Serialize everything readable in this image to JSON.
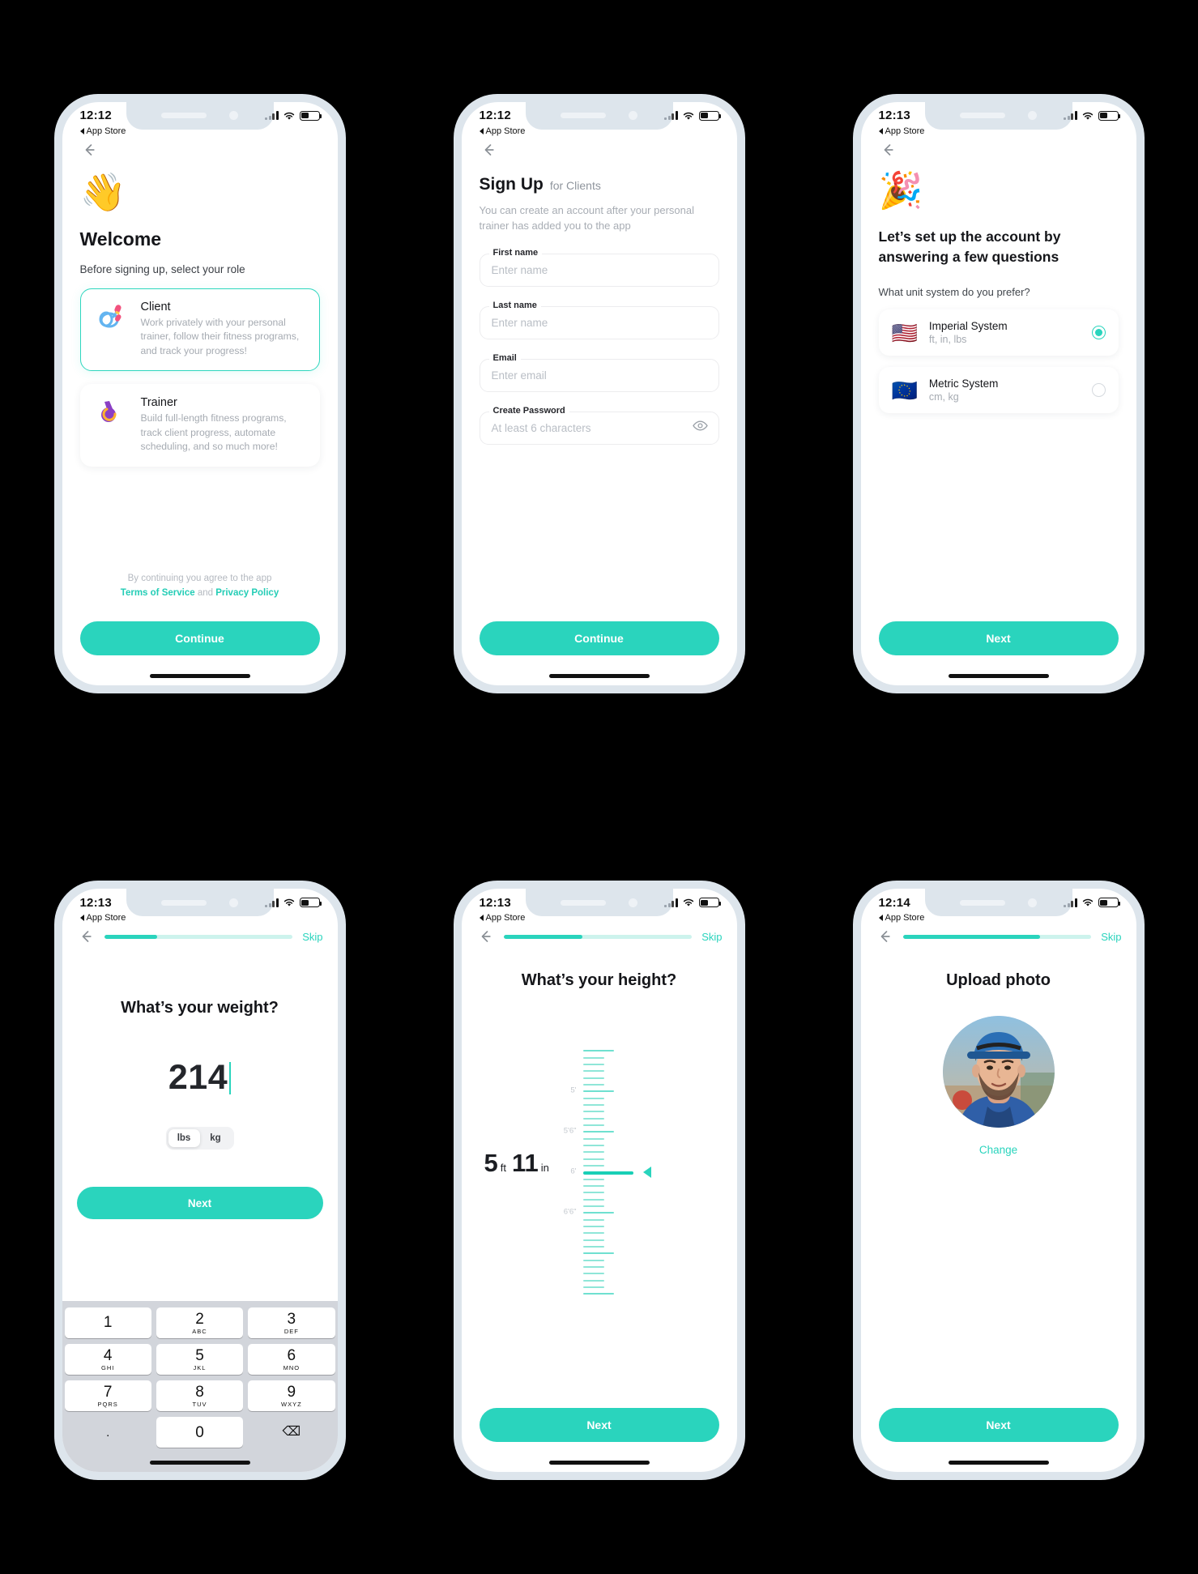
{
  "statusbar": {
    "back_label": "App Store"
  },
  "screens": [
    {
      "id": "welcome",
      "time": "12:12",
      "emoji": "👋",
      "title": "Welcome",
      "subtitle": "Before signing up, select your role",
      "roles": [
        {
          "title": "Client",
          "desc": "Work privately with your personal trainer, follow their fitness programs, and track your progress!",
          "selected": true
        },
        {
          "title": "Trainer",
          "desc": "Build full-length fitness programs, track client progress, automate scheduling, and so much more!",
          "selected": false
        }
      ],
      "terms_prefix": "By continuing you agree to the app",
      "terms_link1": "Terms of Service",
      "terms_and": "and",
      "terms_link2": "Privacy Policy",
      "cta": "Continue"
    },
    {
      "id": "signup",
      "time": "12:12",
      "title_bold": "Sign Up",
      "title_light": "for Clients",
      "desc": "You can create an account after your personal trainer has added you to the app",
      "fields": [
        {
          "label": "First name",
          "placeholder": "Enter name",
          "value": ""
        },
        {
          "label": "Last name",
          "placeholder": "Enter name",
          "value": ""
        },
        {
          "label": "Email",
          "placeholder": "Enter email",
          "value": ""
        },
        {
          "label": "Create Password",
          "placeholder": "At least 6 characters",
          "value": ""
        }
      ],
      "cta": "Continue"
    },
    {
      "id": "setup",
      "time": "12:13",
      "emoji": "🎉",
      "title": "Let’s set up the account by answering a few questions",
      "question": "What unit system do you prefer?",
      "options": [
        {
          "flag": "🇺🇸",
          "name": "Imperial System",
          "sub": "ft, in, lbs",
          "selected": true
        },
        {
          "flag": "🇪🇺",
          "name": "Metric System",
          "sub": "cm, kg",
          "selected": false
        }
      ],
      "cta": "Next"
    },
    {
      "id": "weight",
      "time": "12:13",
      "skip": "Skip",
      "progress": 28,
      "question": "What’s your weight?",
      "value": "214",
      "units": [
        {
          "label": "lbs",
          "on": true
        },
        {
          "label": "kg",
          "on": false
        }
      ],
      "cta": "Next",
      "keypad": [
        {
          "n": "1",
          "s": ""
        },
        {
          "n": "2",
          "s": "ABC"
        },
        {
          "n": "3",
          "s": "DEF"
        },
        {
          "n": "4",
          "s": "GHI"
        },
        {
          "n": "5",
          "s": "JKL"
        },
        {
          "n": "6",
          "s": "MNO"
        },
        {
          "n": "7",
          "s": "PQRS"
        },
        {
          "n": "8",
          "s": "TUV"
        },
        {
          "n": "9",
          "s": "WXYZ"
        },
        {
          "n": ".",
          "s": ""
        },
        {
          "n": "0",
          "s": ""
        },
        {
          "n": "⌫",
          "s": ""
        }
      ]
    },
    {
      "id": "height",
      "time": "12:13",
      "skip": "Skip",
      "progress": 42,
      "question": "What’s your height?",
      "feet": "5",
      "feet_unit": "ft",
      "inches": "11",
      "inches_unit": "in",
      "ruler_labels": [
        "5'",
        "5'6\"",
        "6'",
        "6'6\""
      ],
      "cta": "Next"
    },
    {
      "id": "photo",
      "time": "12:14",
      "skip": "Skip",
      "progress": 73,
      "title": "Upload photo",
      "change": "Change",
      "cta": "Next"
    }
  ],
  "colors": {
    "accent": "#2ad4bd",
    "text": "#15161a",
    "muted": "#a6abb2"
  }
}
